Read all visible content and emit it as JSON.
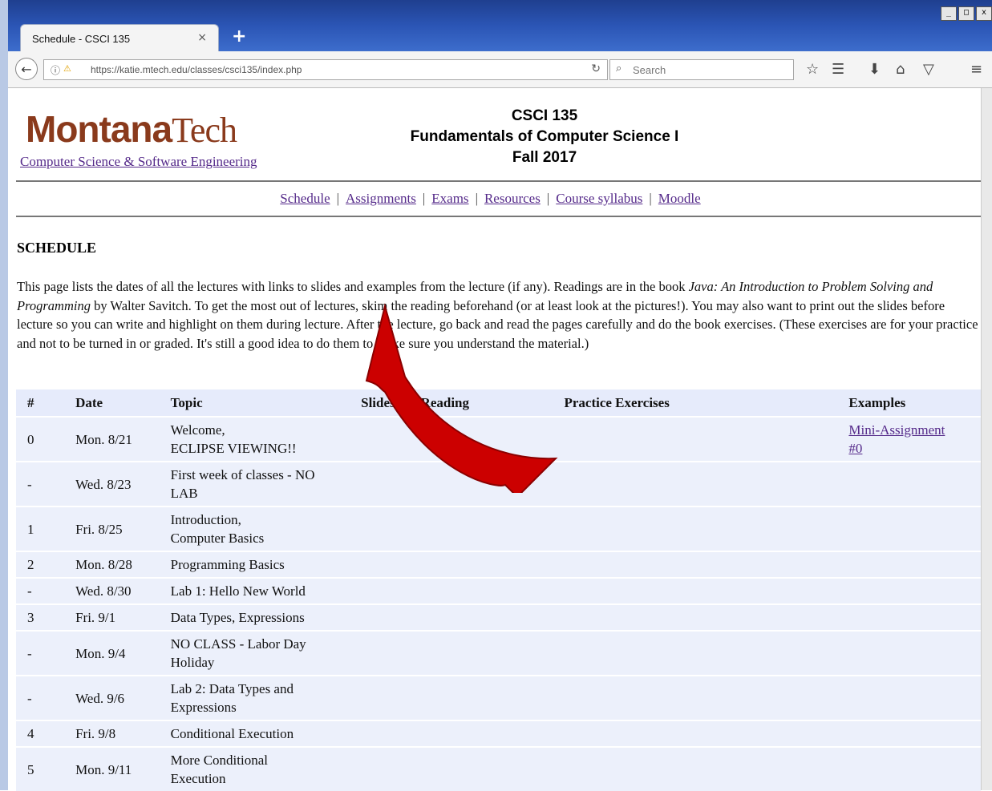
{
  "browser": {
    "tab_title": "Schedule - CSCI 135",
    "tab_close": "×",
    "new_tab": "+",
    "window_buttons": [
      "_",
      "□",
      "x"
    ],
    "url": "https://katie.mtech.edu/classes/csci135/index.php",
    "search_placeholder": "Search"
  },
  "header": {
    "logo_montana": "Montana",
    "logo_tech": "Tech",
    "dept_link": "Computer Science & Software Engineering",
    "course_code": "CSCI 135",
    "course_name": "Fundamentals of Computer Science I",
    "term": "Fall 2017"
  },
  "nav": {
    "links": [
      "Schedule",
      "Assignments",
      "Exams",
      "Resources",
      "Course syllabus",
      "Moodle"
    ],
    "separator": "|"
  },
  "section_title": "SCHEDULE",
  "intro": {
    "part1": "This page lists the dates of all the lectures with links to slides and examples from the lecture (if any). Readings are in the book ",
    "book_title": "Java: An Introduction to Problem Solving and Programming",
    "part2": " by Walter Savitch. To get the most out of lectures, skim the reading beforehand (or at least look at the pictures!). You may also want to print out the slides before lecture so you can write and highlight on them during lecture. After the lecture, go back and read the pages carefully and do the book exercises. (These exercises are for your practice and not to be turned in or graded. It's still a good idea to do them to make sure you understand the material.)"
  },
  "table": {
    "headers": [
      "#",
      "Date",
      "Topic",
      "Slides",
      "Reading",
      "Practice Exercises",
      "Examples"
    ],
    "rows": [
      {
        "num": "0",
        "date": "Mon. 8/21",
        "topic": "Welcome,\nECLIPSE VIEWING!!",
        "example": "Mini-Assignment\n#0"
      },
      {
        "num": "-",
        "date": "Wed. 8/23",
        "topic": "First week of classes - NO\nLAB",
        "example": ""
      },
      {
        "num": "1",
        "date": "Fri. 8/25",
        "topic": "Introduction,\nComputer Basics",
        "example": ""
      },
      {
        "num": "2",
        "date": "Mon. 8/28",
        "topic": "Programming Basics",
        "example": ""
      },
      {
        "num": "-",
        "date": "Wed. 8/30",
        "topic": "Lab 1: Hello New World",
        "example": ""
      },
      {
        "num": "3",
        "date": "Fri. 9/1",
        "topic": "Data Types, Expressions",
        "example": ""
      },
      {
        "num": "-",
        "date": "Mon. 9/4",
        "topic": "NO CLASS - Labor Day\nHoliday",
        "example": ""
      },
      {
        "num": "-",
        "date": "Wed. 9/6",
        "topic": "Lab 2: Data Types and\nExpressions",
        "example": ""
      },
      {
        "num": "4",
        "date": "Fri. 9/8",
        "topic": "Conditional Execution",
        "example": ""
      },
      {
        "num": "5",
        "date": "Mon. 9/11",
        "topic": "More Conditional\nExecution",
        "example": ""
      }
    ]
  },
  "colors": {
    "link": "#552a8a",
    "logo": "#8a3a1c",
    "arrow": "#cc0000",
    "table_bg": "#ecf0fb"
  }
}
